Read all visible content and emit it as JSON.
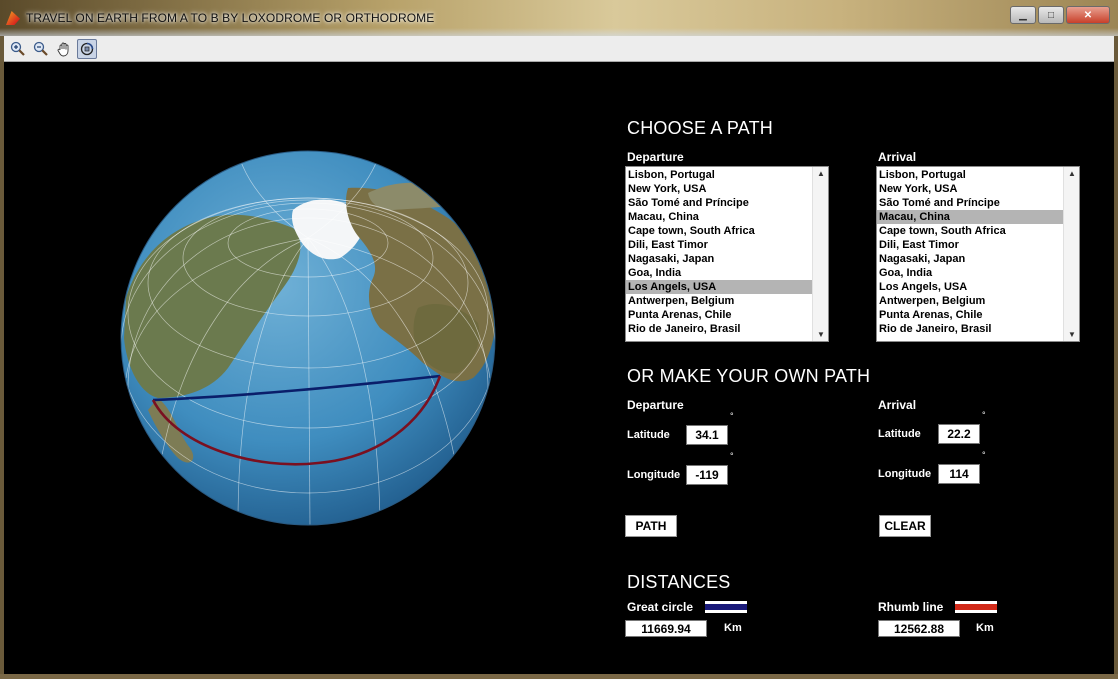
{
  "window": {
    "title": "TRAVEL ON EARTH FROM A TO B BY LOXODROME OR ORTHODROME",
    "minimize_glyph": "▁",
    "maximize_glyph": "□",
    "close_glyph": "✕"
  },
  "toolbar": {
    "tools": [
      {
        "name": "zoom-in-icon"
      },
      {
        "name": "zoom-out-icon"
      },
      {
        "name": "pan-hand-icon"
      },
      {
        "name": "rotate-3d-icon",
        "active": true
      }
    ]
  },
  "choose": {
    "title": "CHOOSE A PATH",
    "departure_label": "Departure",
    "arrival_label": "Arrival",
    "departure_options": [
      "Lisbon, Portugal",
      "New York, USA",
      "São Tomé and Príncipe",
      "Macau, China",
      "Cape town, South Africa",
      "Dili, East Timor",
      "Nagasaki, Japan",
      "Goa, India",
      "Los Angels, USA",
      "Antwerpen, Belgium",
      "Punta Arenas, Chile",
      "Rio de Janeiro, Brasil"
    ],
    "departure_selected": "Los Angels, USA",
    "arrival_options": [
      "Lisbon, Portugal",
      "New York, USA",
      "São Tomé and Príncipe",
      "Macau, China",
      "Cape town, South Africa",
      "Dili, East Timor",
      "Nagasaki, Japan",
      "Goa, India",
      "Los Angels, USA",
      "Antwerpen, Belgium",
      "Punta Arenas, Chile",
      "Rio de Janeiro, Brasil"
    ],
    "arrival_selected": "Macau, China"
  },
  "own": {
    "title": "OR MAKE YOUR OWN PATH",
    "departure_label": "Departure",
    "arrival_label": "Arrival",
    "latitude_label": "Latitude",
    "longitude_label": "Longitude",
    "degree_symbol": "°",
    "dep_lat": "34.1",
    "dep_lon": "-119",
    "arr_lat": "22.2",
    "arr_lon": "114",
    "path_button": "PATH",
    "clear_button": "CLEAR"
  },
  "distances": {
    "title": "DISTANCES",
    "great_circle_label": "Great circle",
    "great_circle_value": "11669.94",
    "great_circle_color": "#1a1a7a",
    "rhumb_label": "Rhumb line",
    "rhumb_value": "12562.88",
    "rhumb_color": "#d22a1a",
    "unit": "Km"
  }
}
